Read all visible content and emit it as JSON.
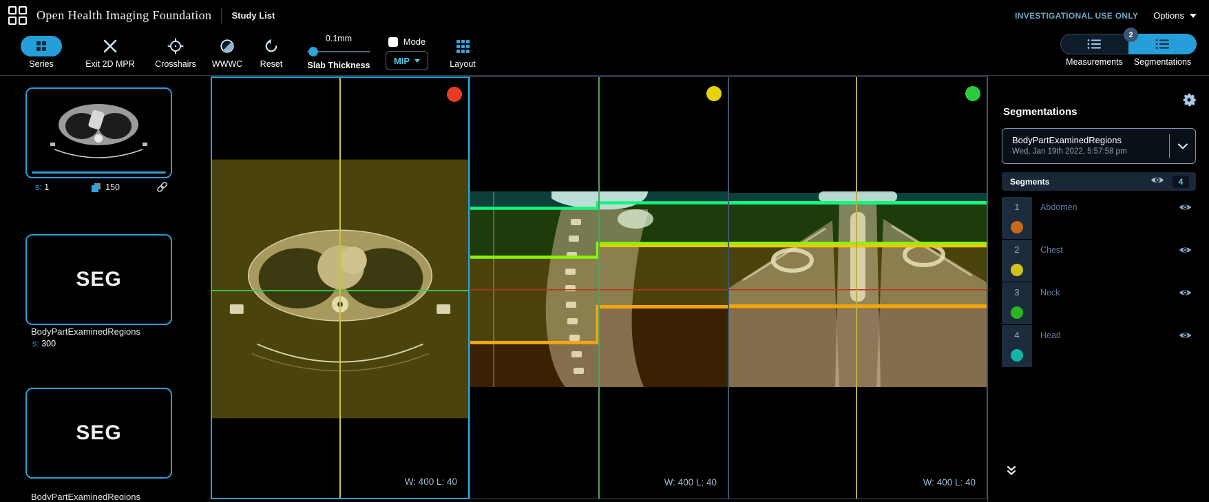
{
  "header": {
    "logo_text": "Open Health Imaging Foundation",
    "study_list_label": "Study List",
    "investigational_label": "INVESTIGATIONAL USE ONLY",
    "options_label": "Options"
  },
  "toolbar": {
    "tools": [
      {
        "label": "Series"
      },
      {
        "label": "Exit 2D MPR"
      },
      {
        "label": "Crosshairs"
      },
      {
        "label": "WWWC"
      },
      {
        "label": "Reset"
      }
    ],
    "slab": {
      "value": "0.1mm",
      "label": "Slab Thickness"
    },
    "mode_label": "Mode",
    "mip_label": "MIP",
    "layout_label": "Layout",
    "panels": {
      "measurements_label": "Measurements",
      "segmentations_label": "Segmentations",
      "badge": "2"
    }
  },
  "study_panel": {
    "thumbnails": [
      {
        "type": "image",
        "series_prefix": "s:",
        "series_number": "1",
        "instance_count": "150"
      },
      {
        "type": "seg",
        "modality": "SEG",
        "description": "BodyPartExaminedRegions",
        "series_prefix": "s:",
        "series_number": "300"
      },
      {
        "type": "seg",
        "modality": "SEG",
        "description": "BodyPartExaminedRegions"
      }
    ]
  },
  "viewports": [
    {
      "orientation": "axial",
      "marker_color": "#ea3b23",
      "wl": "W: 400 L: 40"
    },
    {
      "orientation": "sagittal",
      "marker_color": "#e7d20e",
      "wl": "W: 400 L: 40"
    },
    {
      "orientation": "coronal",
      "marker_color": "#2bcb40",
      "wl": "W: 400 L: 40"
    }
  ],
  "segmentation_panel": {
    "title": "Segmentations",
    "dropdown": {
      "name": "BodyPartExaminedRegions",
      "date": "Wed, Jan 19th 2022, 5:57:58 pm"
    },
    "segments_header": {
      "label": "Segments",
      "count": "4"
    },
    "segments": [
      {
        "index": "1",
        "label": "Abdomen",
        "color": "#c96a1a"
      },
      {
        "index": "2",
        "label": "Chest",
        "color": "#d0c31c"
      },
      {
        "index": "3",
        "label": "Neck",
        "color": "#2cb51f"
      },
      {
        "index": "4",
        "label": "Head",
        "color": "#0fb5a5"
      }
    ]
  },
  "icons": {
    "logo": "four-squares-grid",
    "series": "grid-2x2",
    "exit": "x-cross",
    "crosshairs": "target-circle",
    "wwwc": "half-filled-circle",
    "reset": "rotate-counterclockwise-arrow",
    "layout": "grid-3x3",
    "panel_toggle": "list-lines",
    "settings": "gear",
    "visibility": "eye",
    "link": "chain-link",
    "stack": "stacked-squares",
    "chevron_down": "chevron-down",
    "double_chevron_down": "double-chevron-down"
  },
  "accent_colors": {
    "primary": "#259fd9",
    "highlight": "#5acce6",
    "muted_label": "#5f7a9d"
  }
}
